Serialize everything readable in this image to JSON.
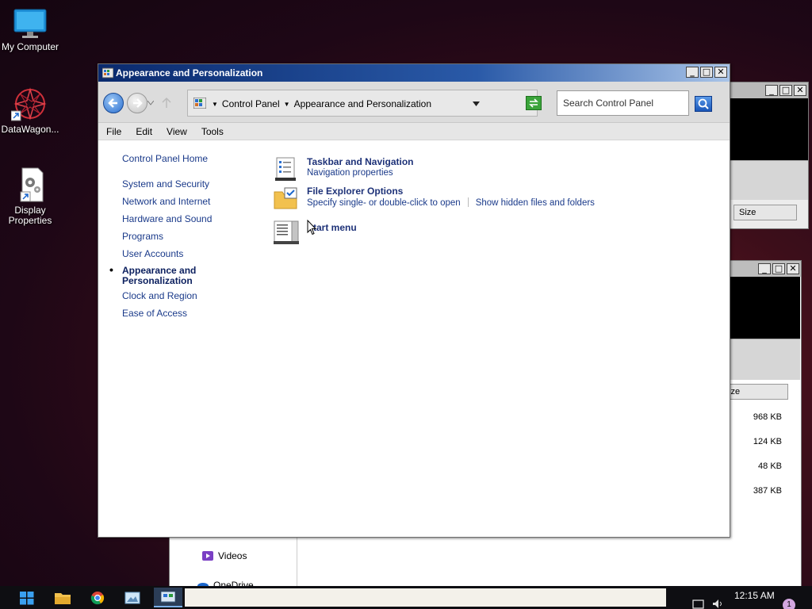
{
  "desktop": {
    "icons": [
      {
        "label": "My Computer",
        "icon": "monitor-icon"
      },
      {
        "label": "DataWagon...",
        "icon": "datawagon-logo-icon"
      },
      {
        "label": "Display\nProperties",
        "icon": "display-properties-icon"
      }
    ]
  },
  "background_windows": {
    "column_size_label": "Size",
    "column_size_label_cut": "ize",
    "sizes": [
      "968 KB",
      "124 KB",
      "48 KB",
      "387 KB"
    ],
    "sidebar_videos": "Videos",
    "sidebar_onedrive_partial": "OneDrive"
  },
  "window": {
    "title": "Appearance and Personalization",
    "controls": {
      "minimize": "_",
      "maximize": "□",
      "close": "✕"
    },
    "breadcrumb": [
      "Control Panel",
      "Appearance and Personalization"
    ],
    "search_placeholder": "Search Control Panel",
    "menu": [
      "File",
      "Edit",
      "View",
      "Tools"
    ],
    "left_nav": {
      "home": "Control Panel Home",
      "items": [
        "System and Security",
        "Network and Internet",
        "Hardware and Sound",
        "Programs",
        "User Accounts"
      ],
      "current": "Appearance and Personalization",
      "items_after": [
        "Clock and Region",
        "Ease of Access"
      ]
    },
    "tasks": [
      {
        "title": "Taskbar and Navigation",
        "links": [
          "Navigation properties"
        ],
        "icon": "taskbar-icon"
      },
      {
        "title": "File Explorer Options",
        "links": [
          "Specify single- or double-click to open",
          "Show hidden files and folders"
        ],
        "icon": "folder-options-icon"
      },
      {
        "title": "Start menu",
        "links": [],
        "icon": "start-menu-icon"
      }
    ]
  },
  "taskbar": {
    "time": "12:15 AM",
    "notification_count": "1"
  }
}
